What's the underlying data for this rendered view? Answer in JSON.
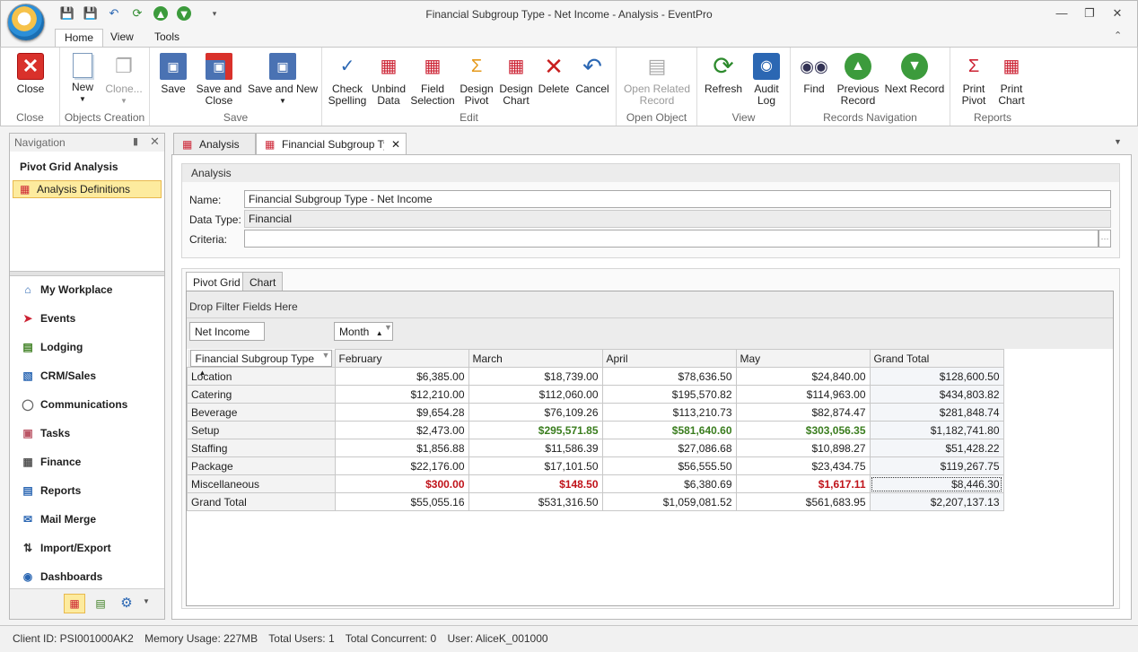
{
  "window": {
    "title": "Financial Subgroup Type - Net Income - Analysis - EventPro"
  },
  "quick_access": [
    "save-icon",
    "save-close-icon",
    "undo-icon",
    "refresh-icon",
    "up-icon",
    "down-icon",
    "customize-icon"
  ],
  "ribbon_tabs": [
    "Home",
    "View",
    "Tools"
  ],
  "ribbon": {
    "close": {
      "label": "Close",
      "group": "Close"
    },
    "new": {
      "label": "New"
    },
    "clone": {
      "label": "Clone..."
    },
    "objects_group": "Objects Creation",
    "save": {
      "label": "Save"
    },
    "save_close": {
      "label1": "Save and",
      "label2": "Close"
    },
    "save_new": {
      "label": "Save and New"
    },
    "save_group": "Save",
    "check": {
      "label1": "Check",
      "label2": "Spelling"
    },
    "unbind": {
      "label1": "Unbind",
      "label2": "Data"
    },
    "field": {
      "label1": "Field",
      "label2": "Selection"
    },
    "design_pivot": {
      "label1": "Design",
      "label2": "Pivot"
    },
    "design_chart": {
      "label1": "Design",
      "label2": "Chart"
    },
    "delete": {
      "label": "Delete"
    },
    "cancel": {
      "label": "Cancel"
    },
    "edit_group": "Edit",
    "open_related": {
      "label1": "Open Related",
      "label2": "Record"
    },
    "open_group": "Open Object",
    "refresh": {
      "label": "Refresh"
    },
    "audit": {
      "label1": "Audit",
      "label2": "Log"
    },
    "view_group": "View",
    "find": {
      "label": "Find"
    },
    "prev": {
      "label1": "Previous",
      "label2": "Record"
    },
    "next": {
      "label": "Next Record"
    },
    "records_group": "Records Navigation",
    "print_pivot": {
      "label1": "Print",
      "label2": "Pivot"
    },
    "print_chart": {
      "label1": "Print",
      "label2": "Chart"
    },
    "reports_group": "Reports"
  },
  "nav": {
    "header": "Navigation",
    "title": "Pivot Grid Analysis",
    "selected": "Analysis Definitions",
    "items": [
      {
        "label": "My Workplace",
        "icon": "house-icon"
      },
      {
        "label": "Events",
        "icon": "pin-icon"
      },
      {
        "label": "Lodging",
        "icon": "bed-icon"
      },
      {
        "label": "CRM/Sales",
        "icon": "contacts-icon"
      },
      {
        "label": "Communications",
        "icon": "speech-icon"
      },
      {
        "label": "Tasks",
        "icon": "clipboard-icon"
      },
      {
        "label": "Finance",
        "icon": "calculator-icon"
      },
      {
        "label": "Reports",
        "icon": "report-icon"
      },
      {
        "label": "Mail Merge",
        "icon": "mail-icon"
      },
      {
        "label": "Import/Export",
        "icon": "arrows-icon"
      },
      {
        "label": "Dashboards",
        "icon": "globe-icon"
      }
    ]
  },
  "doc_tabs": [
    "Analysis",
    "Financial Subgroup Type"
  ],
  "analysis": {
    "header": "Analysis",
    "name_label": "Name:",
    "name_value": "Financial Subgroup Type - Net Income",
    "type_label": "Data Type:",
    "type_value": "Financial",
    "criteria_label": "Criteria:",
    "criteria_value": "",
    "criteria_btn": "···"
  },
  "pivot_tabs": [
    "Pivot Grid",
    "Chart"
  ],
  "pivot": {
    "drop_filter": "Drop Filter Fields Here",
    "data_field": "Net Income",
    "column_field": "Month",
    "row_field": "Financial Subgroup Type",
    "columns": [
      "February",
      "March",
      "April",
      "May",
      "Grand Total"
    ],
    "rows": [
      {
        "label": "Location",
        "values": [
          "$6,385.00",
          "$18,739.00",
          "$78,636.50",
          "$24,840.00",
          "$128,600.50"
        ],
        "style": [
          "",
          "",
          "",
          "",
          ""
        ]
      },
      {
        "label": "Catering",
        "values": [
          "$12,210.00",
          "$112,060.00",
          "$195,570.82",
          "$114,963.00",
          "$434,803.82"
        ],
        "style": [
          "",
          "",
          "",
          "",
          ""
        ]
      },
      {
        "label": "Beverage",
        "values": [
          "$9,654.28",
          "$76,109.26",
          "$113,210.73",
          "$82,874.47",
          "$281,848.74"
        ],
        "style": [
          "",
          "",
          "",
          "",
          ""
        ]
      },
      {
        "label": "Setup",
        "values": [
          "$2,473.00",
          "$295,571.85",
          "$581,640.60",
          "$303,056.35",
          "$1,182,741.80"
        ],
        "style": [
          "",
          "pos",
          "pos",
          "pos",
          ""
        ]
      },
      {
        "label": "Staffing",
        "values": [
          "$1,856.88",
          "$11,586.39",
          "$27,086.68",
          "$10,898.27",
          "$51,428.22"
        ],
        "style": [
          "",
          "",
          "",
          "",
          ""
        ]
      },
      {
        "label": "Package",
        "values": [
          "$22,176.00",
          "$17,101.50",
          "$56,555.50",
          "$23,434.75",
          "$119,267.75"
        ],
        "style": [
          "",
          "",
          "",
          "",
          ""
        ]
      },
      {
        "label": "Miscellaneous",
        "values": [
          "$300.00",
          "$148.50",
          "$6,380.69",
          "$1,617.11",
          "$8,446.30"
        ],
        "style": [
          "neg",
          "neg",
          "",
          "neg",
          ""
        ]
      },
      {
        "label": "Grand Total",
        "values": [
          "$55,055.16",
          "$531,316.50",
          "$1,059,081.52",
          "$561,683.95",
          "$2,207,137.13"
        ],
        "style": [
          "",
          "",
          "",
          "",
          ""
        ]
      }
    ]
  },
  "status": [
    "Client ID: PSI001000AK2",
    "Memory Usage: 227MB",
    "Total Users: 1",
    "Total Concurrent: 0",
    "User: AliceK_001000"
  ],
  "colors": {
    "positive": "#3a7d1e",
    "negative": "#c0131a",
    "nav_selected": "#fdeb9e"
  }
}
